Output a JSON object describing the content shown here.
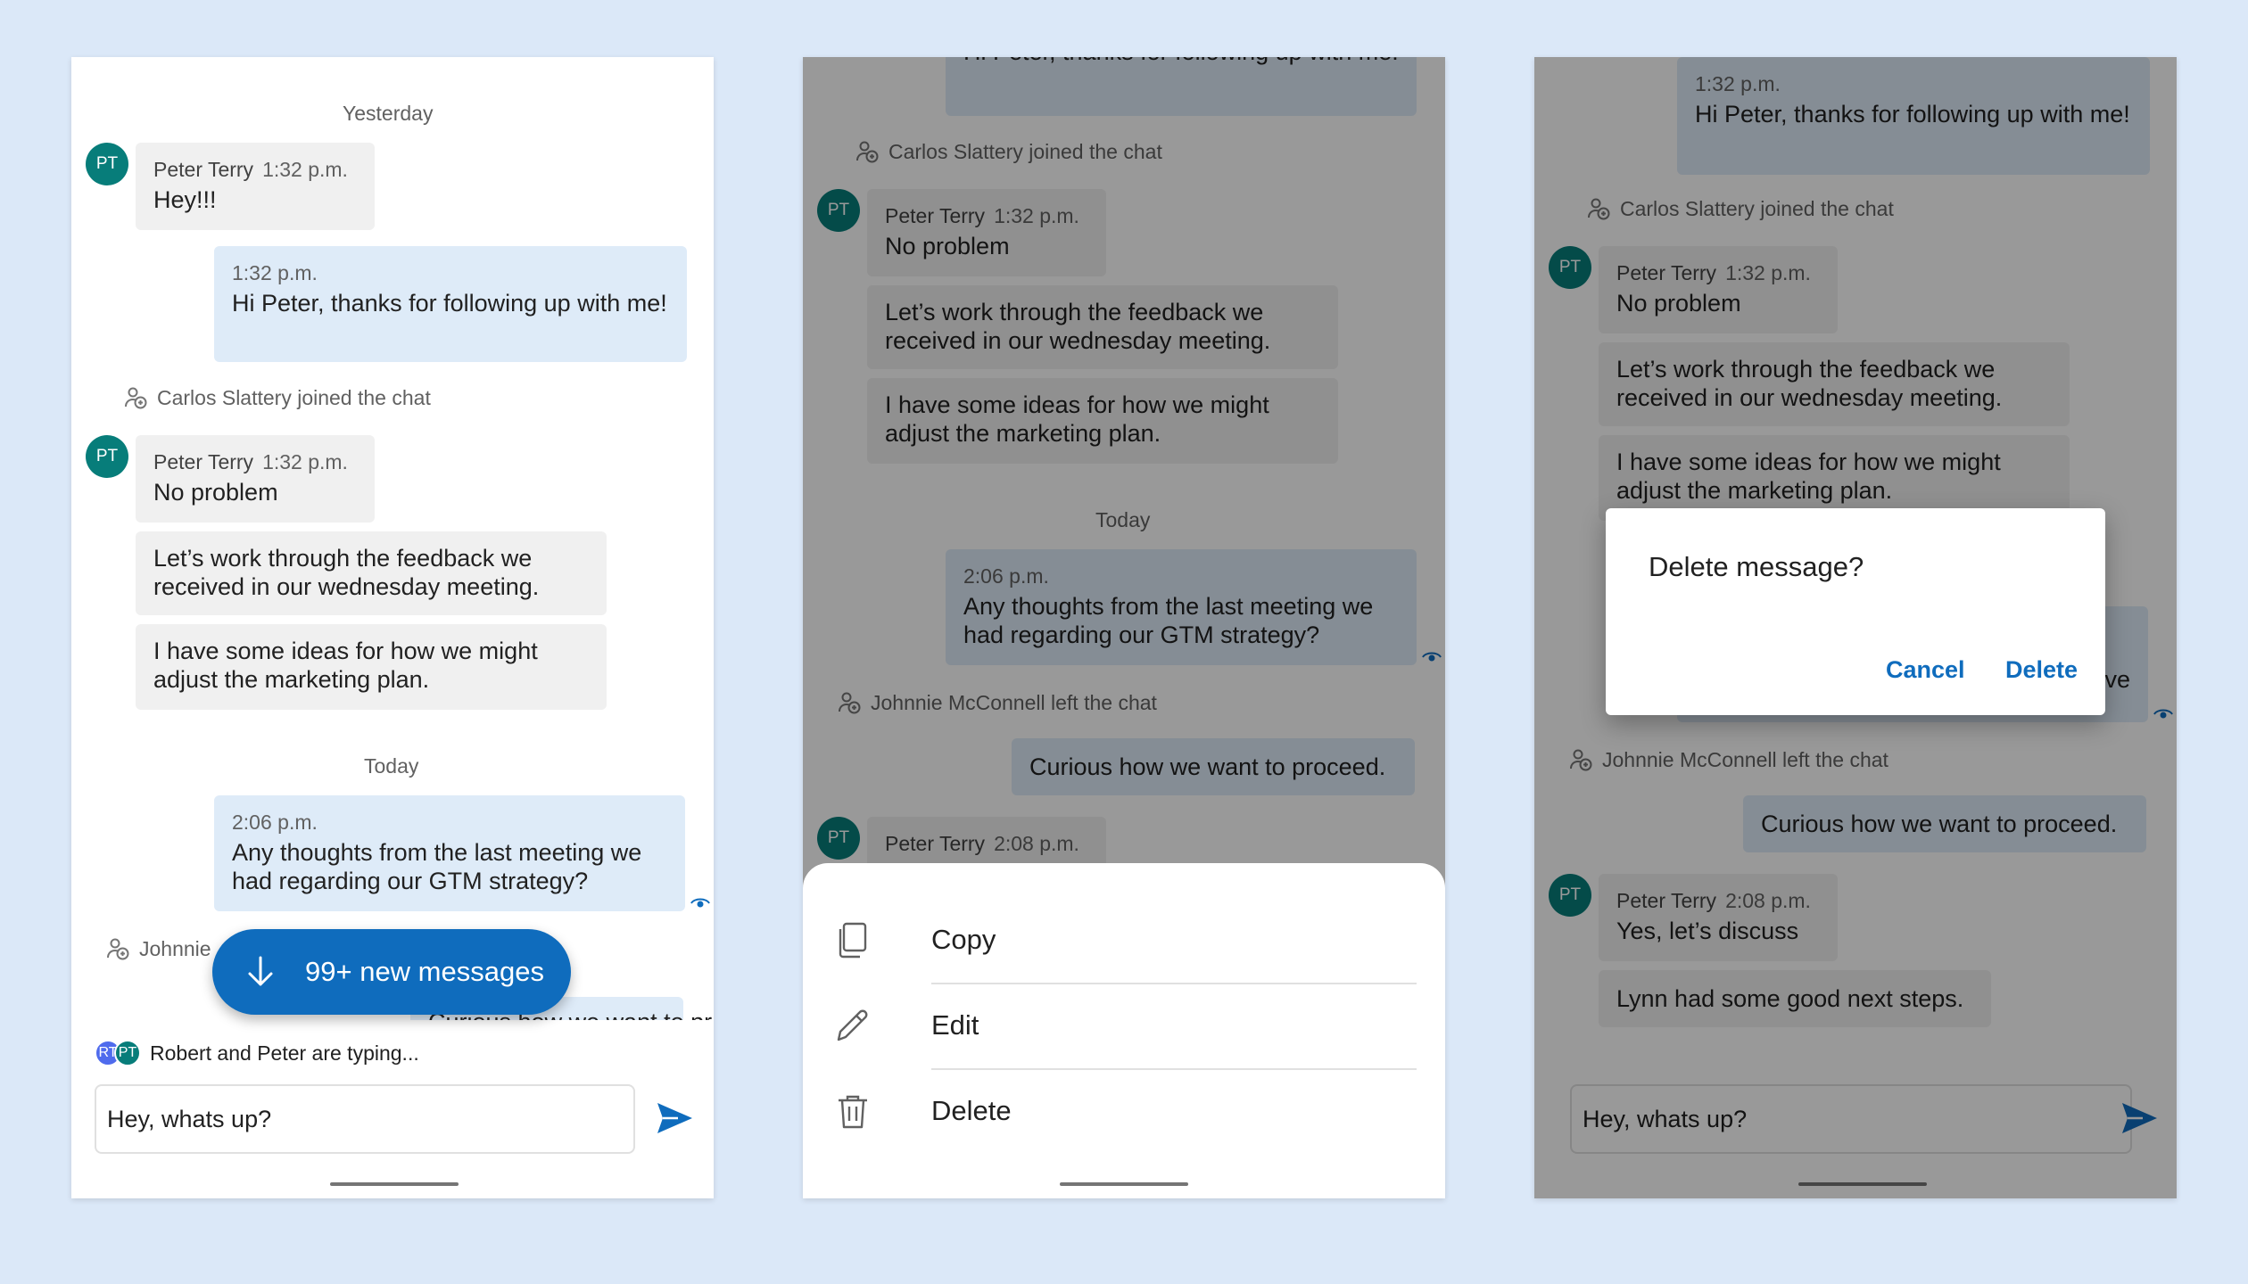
{
  "colors": {
    "background": "#dbe8f8",
    "brand": "#0f6cbd",
    "avatar_teal": "#077d7a",
    "avatar_blue": "#4f6bed",
    "incoming_bubble": "#f0f0f0",
    "outgoing_bubble": "#deebf8"
  },
  "screen1": {
    "divider_yesterday": "Yesterday",
    "msg1": {
      "avatar": "PT",
      "sender": "Peter Terry",
      "time": "1:32 p.m.",
      "text": "Hey!!!"
    },
    "msg2": {
      "time": "1:32 p.m.",
      "text": "Hi Peter, thanks for following up with me!"
    },
    "system1": "Carlos Slattery joined the chat",
    "msg3": {
      "avatar": "PT",
      "sender": "Peter Terry",
      "time": "1:32 p.m.",
      "text": "No problem"
    },
    "msg4": "Let’s work through the feedback we received in our wednesday meeting.",
    "msg5": "I have some ideas for how we might adjust the marketing plan.",
    "divider_today": "Today",
    "msg6": {
      "time": "2:06 p.m.",
      "text": "Any thoughts from the last meeting we had regarding our GTM strategy?"
    },
    "system2_partial": "Johnnie",
    "msg7_partial": "Curious how we want to proceed.",
    "new_messages": "99+ new messages",
    "typing_avatars": [
      "RT",
      "PT"
    ],
    "typing_text": "Robert and Peter are typing...",
    "composer_value": "Hey, whats up?"
  },
  "screen2": {
    "msg2_tail": "Hi Peter, thanks for following up with me!",
    "system1": "Carlos Slattery joined the chat",
    "msg3": {
      "avatar": "PT",
      "sender": "Peter Terry",
      "time": "1:32 p.m.",
      "text": "No problem"
    },
    "msg4": "Let’s work through the feedback we received in our wednesday meeting.",
    "msg5": "I have some ideas for how we might adjust the marketing plan.",
    "divider_today": "Today",
    "msg6": {
      "time": "2:06 p.m.",
      "text": "Any thoughts from the last meeting we had regarding our GTM strategy?"
    },
    "system2": "Johnnie McConnell left the chat",
    "msg7": "Curious how we want to proceed.",
    "msg8": {
      "avatar": "PT",
      "sender": "Peter Terry",
      "time": "2:08 p.m."
    },
    "sheet": {
      "copy_label": "Copy",
      "edit_label": "Edit",
      "delete_label": "Delete"
    }
  },
  "screen3": {
    "msg2": {
      "time": "1:32 p.m.",
      "text": "Hi Peter, thanks for following up with me!"
    },
    "system1": "Carlos Slattery joined the chat",
    "msg3": {
      "avatar": "PT",
      "sender": "Peter Terry",
      "time": "1:32 p.m.",
      "text": "No problem"
    },
    "msg4": "Let’s work through the feedback we received in our wednesday meeting.",
    "msg5": "I have some ideas for how we might adjust the marketing plan.",
    "msg6_peek": "ve",
    "system2": "Johnnie McConnell left the chat",
    "msg7": "Curious how we want to proceed.",
    "msg8": {
      "avatar": "PT",
      "sender": "Peter Terry",
      "time": "2:08 p.m.",
      "text": "Yes, let’s discuss"
    },
    "msg9": "Lynn had some good next steps.",
    "composer_value": "Hey, whats up?",
    "dialog": {
      "title": "Delete message?",
      "cancel_label": "Cancel",
      "delete_label": "Delete"
    }
  }
}
